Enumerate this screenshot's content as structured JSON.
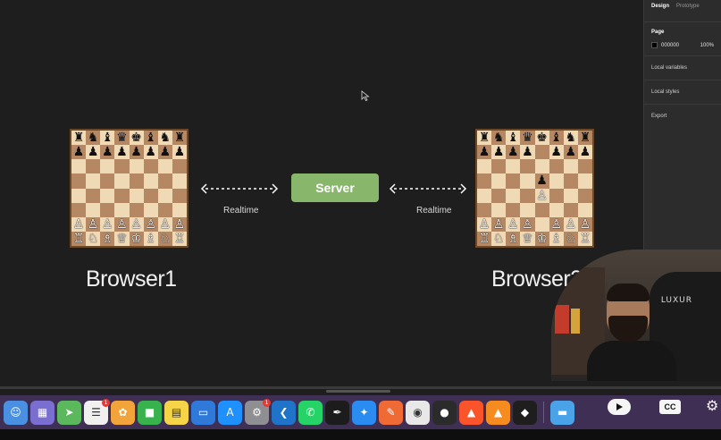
{
  "canvas": {
    "server_label": "Server",
    "left_realtime": "Realtime",
    "right_realtime": "Realtime",
    "browser1_label": "Browser1",
    "browser2_label": "Browser2"
  },
  "boards": {
    "browser1": [
      "♜♞♝♛♚♝♞♜",
      "♟♟♟♟♟♟♟♟",
      "        ",
      "        ",
      "        ",
      "        ",
      "♙♙♙♙♙♙♙♙",
      "♖♘♗♕♔♗♘♖"
    ],
    "browser2": [
      "♜♞♝♛♚♝♞♜",
      "♟♟♟♟ ♟♟♟",
      "        ",
      "    ♟   ",
      "    ♙   ",
      "        ",
      "♙♙♙♙ ♙♙♙",
      "♖♘♗♕♔♗♘♖"
    ]
  },
  "panel": {
    "tabs": [
      "Design",
      "Prototype"
    ],
    "page_heading": "Page",
    "page_color": "000000",
    "page_opacity": "100%",
    "local_variables": "Local variables",
    "local_styles": "Local styles",
    "export": "Export"
  },
  "webcam": {
    "chair_brand": "LUXUR"
  },
  "player": {
    "cc_label": "CC"
  },
  "dock": {
    "apps": [
      {
        "name": "finder",
        "color": "#4a90e2",
        "glyph": "☺"
      },
      {
        "name": "launchpad",
        "color": "#7a6fd0",
        "glyph": "▦"
      },
      {
        "name": "maps",
        "color": "#5cb85c",
        "glyph": "➤"
      },
      {
        "name": "reminders",
        "color": "#f0f0f0",
        "glyph": "☰",
        "badge": "1"
      },
      {
        "name": "photos",
        "color": "#f2a33a",
        "glyph": "✿"
      },
      {
        "name": "facetime",
        "color": "#37b24d",
        "glyph": "■"
      },
      {
        "name": "notes",
        "color": "#f5d547",
        "glyph": "▤"
      },
      {
        "name": "keynote",
        "color": "#2f7ad8",
        "glyph": "▭"
      },
      {
        "name": "app-store",
        "color": "#1e90ff",
        "glyph": "A"
      },
      {
        "name": "system-settings",
        "color": "#8e8e93",
        "glyph": "⚙",
        "badge": "1"
      },
      {
        "name": "vscode",
        "color": "#1f73c8",
        "glyph": "❮"
      },
      {
        "name": "whatsapp",
        "color": "#25d366",
        "glyph": "✆"
      },
      {
        "name": "pen-tool",
        "color": "#1c1c1c",
        "glyph": "✒"
      },
      {
        "name": "safari",
        "color": "#2a8cf0",
        "glyph": "✦"
      },
      {
        "name": "pencil",
        "color": "#f06a35",
        "glyph": "✎"
      },
      {
        "name": "chrome",
        "color": "#e8e8e8",
        "glyph": "◉"
      },
      {
        "name": "obs",
        "color": "#2b2b2b",
        "glyph": "●"
      },
      {
        "name": "brave",
        "color": "#fb542b",
        "glyph": "▲"
      },
      {
        "name": "vlc",
        "color": "#f68b1f",
        "glyph": "▲"
      },
      {
        "name": "figma",
        "color": "#1e1e1e",
        "glyph": "◆"
      }
    ],
    "trailing": [
      {
        "name": "folder",
        "color": "#4aa3e8",
        "glyph": "▬"
      }
    ]
  }
}
